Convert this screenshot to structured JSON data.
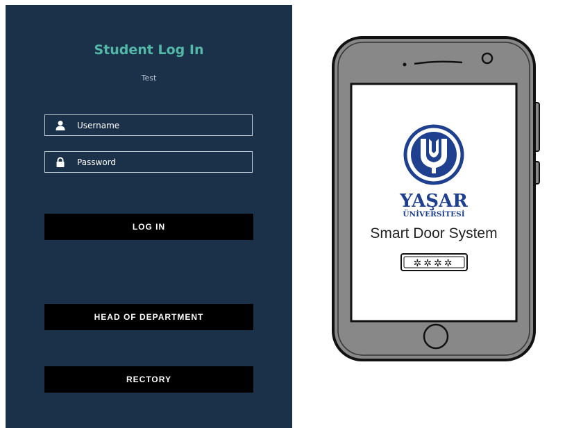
{
  "login": {
    "title": "Student Log In",
    "subtitle": "Test",
    "username_placeholder": "Username",
    "password_placeholder": "Password",
    "login_button": "LOG IN",
    "hod_button": "HEAD OF DEPARTMENT",
    "rectory_button": "RECTORY"
  },
  "illustration": {
    "brand_name": "YAŞAR",
    "brand_sub": "ÜNİVERSİTESİ",
    "caption": "Smart Door System",
    "code_glyphs": "✲✲✲✲"
  },
  "colors": {
    "panel_background": "#1b3149",
    "title_accent": "#53b8a8",
    "button_background": "#000000",
    "brand_blue": "#1f3f8f"
  }
}
